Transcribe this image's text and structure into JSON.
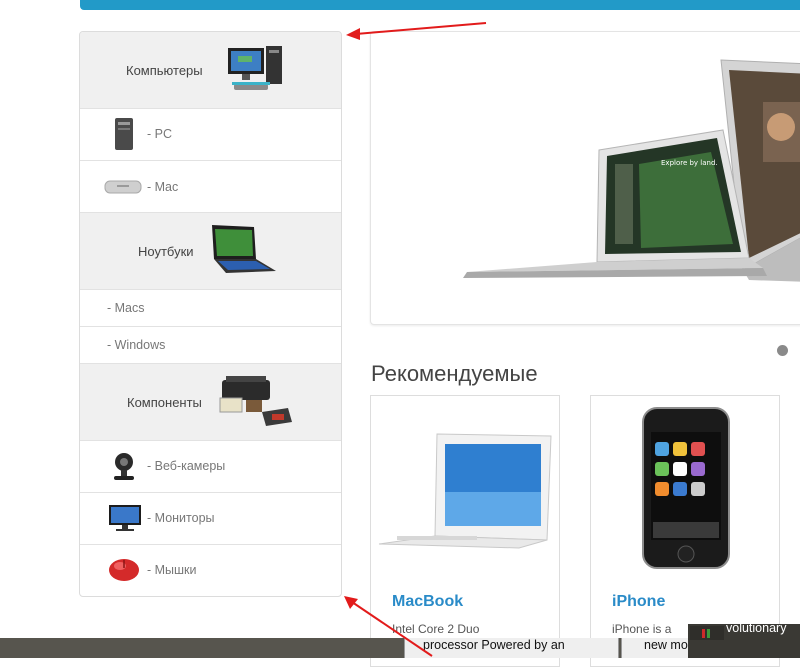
{
  "sidebar": {
    "items": [
      {
        "label": "Компьютеры",
        "kind": "category",
        "icon": "computer-icon"
      },
      {
        "label": "- PC",
        "kind": "subcategory",
        "icon": "pc-tower-icon"
      },
      {
        "label": "- Mac",
        "kind": "subcategory",
        "icon": "mac-mini-icon"
      },
      {
        "label": "Ноутбуки",
        "kind": "category",
        "icon": "laptop-icon"
      },
      {
        "label": "- Macs",
        "kind": "subcategory"
      },
      {
        "label": "- Windows",
        "kind": "subcategory"
      },
      {
        "label": "Компоненты",
        "kind": "category",
        "icon": "components-icon"
      },
      {
        "label": "- Веб-камеры",
        "kind": "subcategory",
        "icon": "webcam-icon"
      },
      {
        "label": "- Мониторы",
        "kind": "subcategory",
        "icon": "monitor-icon"
      },
      {
        "label": "- Мышки",
        "kind": "subcategory",
        "icon": "mouse-icon"
      }
    ]
  },
  "recommended": {
    "title": "Рекомендуемые",
    "products": [
      {
        "name": "MacBook",
        "desc": "Intel Core 2 Duo"
      },
      {
        "name": "iPhone",
        "desc": "iPhone is a"
      }
    ]
  },
  "taskbar": {
    "seg1": "processor Powered by an",
    "seg2": "new mobile phone that",
    "seg3": "volutionary"
  },
  "colors": {
    "accent": "#229ac8",
    "product_link": "#2a8bc8",
    "annotation_arrow": "#e21b1b"
  }
}
